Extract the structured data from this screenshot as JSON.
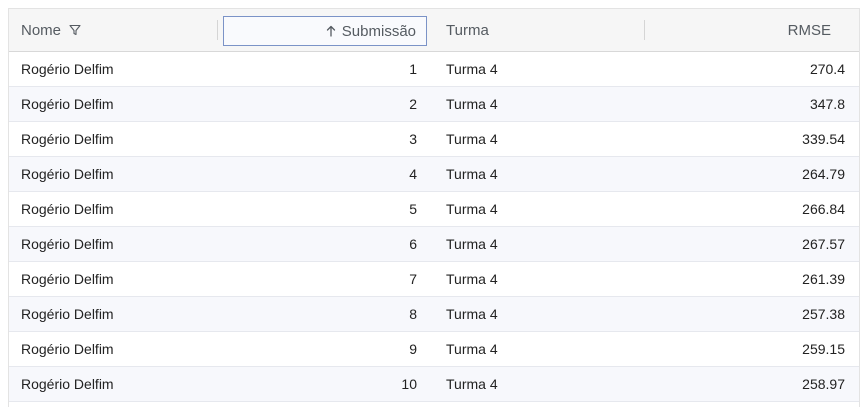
{
  "table": {
    "columns": {
      "nome": "Nome",
      "submissao": "Submissão",
      "turma": "Turma",
      "rmse": "RMSE"
    },
    "sort": {
      "column": "Submissão",
      "direction": "ascending",
      "icon": "arrow-up-icon"
    },
    "filter_icon": "filter-icon",
    "rows": [
      {
        "nome": "Rogério Delfim",
        "submissao": "1",
        "turma": "Turma 4",
        "rmse": "270.4"
      },
      {
        "nome": "Rogério Delfim",
        "submissao": "2",
        "turma": "Turma 4",
        "rmse": "347.8"
      },
      {
        "nome": "Rogério Delfim",
        "submissao": "3",
        "turma": "Turma 4",
        "rmse": "339.54"
      },
      {
        "nome": "Rogério Delfim",
        "submissao": "4",
        "turma": "Turma 4",
        "rmse": "264.79"
      },
      {
        "nome": "Rogério Delfim",
        "submissao": "5",
        "turma": "Turma 4",
        "rmse": "266.84"
      },
      {
        "nome": "Rogério Delfim",
        "submissao": "6",
        "turma": "Turma 4",
        "rmse": "267.57"
      },
      {
        "nome": "Rogério Delfim",
        "submissao": "7",
        "turma": "Turma 4",
        "rmse": "261.39"
      },
      {
        "nome": "Rogério Delfim",
        "submissao": "8",
        "turma": "Turma 4",
        "rmse": "257.38"
      },
      {
        "nome": "Rogério Delfim",
        "submissao": "9",
        "turma": "Turma 4",
        "rmse": "259.15"
      },
      {
        "nome": "Rogério Delfim",
        "submissao": "10",
        "turma": "Turma 4",
        "rmse": "258.97"
      }
    ]
  },
  "colors": {
    "header_bg": "#f6f6f6",
    "header_text": "#555b61",
    "sorted_header_border": "#7b93c7",
    "alt_row_bg": "#f7f8fc",
    "row_border": "#e6e8ee"
  }
}
